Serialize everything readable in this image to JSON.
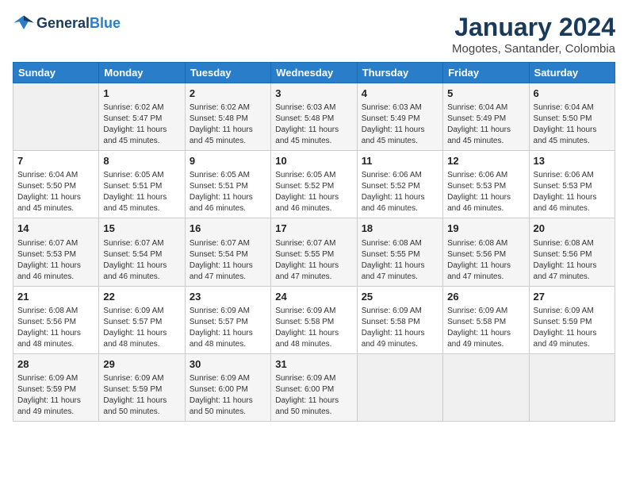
{
  "header": {
    "logo_line1": "General",
    "logo_line2": "Blue",
    "main_title": "January 2024",
    "subtitle": "Mogotes, Santander, Colombia"
  },
  "columns": [
    "Sunday",
    "Monday",
    "Tuesday",
    "Wednesday",
    "Thursday",
    "Friday",
    "Saturday"
  ],
  "weeks": [
    [
      {
        "day": "",
        "info": ""
      },
      {
        "day": "1",
        "info": "Sunrise: 6:02 AM\nSunset: 5:47 PM\nDaylight: 11 hours\nand 45 minutes."
      },
      {
        "day": "2",
        "info": "Sunrise: 6:02 AM\nSunset: 5:48 PM\nDaylight: 11 hours\nand 45 minutes."
      },
      {
        "day": "3",
        "info": "Sunrise: 6:03 AM\nSunset: 5:48 PM\nDaylight: 11 hours\nand 45 minutes."
      },
      {
        "day": "4",
        "info": "Sunrise: 6:03 AM\nSunset: 5:49 PM\nDaylight: 11 hours\nand 45 minutes."
      },
      {
        "day": "5",
        "info": "Sunrise: 6:04 AM\nSunset: 5:49 PM\nDaylight: 11 hours\nand 45 minutes."
      },
      {
        "day": "6",
        "info": "Sunrise: 6:04 AM\nSunset: 5:50 PM\nDaylight: 11 hours\nand 45 minutes."
      }
    ],
    [
      {
        "day": "7",
        "info": "Sunrise: 6:04 AM\nSunset: 5:50 PM\nDaylight: 11 hours\nand 45 minutes."
      },
      {
        "day": "8",
        "info": "Sunrise: 6:05 AM\nSunset: 5:51 PM\nDaylight: 11 hours\nand 45 minutes."
      },
      {
        "day": "9",
        "info": "Sunrise: 6:05 AM\nSunset: 5:51 PM\nDaylight: 11 hours\nand 46 minutes."
      },
      {
        "day": "10",
        "info": "Sunrise: 6:05 AM\nSunset: 5:52 PM\nDaylight: 11 hours\nand 46 minutes."
      },
      {
        "day": "11",
        "info": "Sunrise: 6:06 AM\nSunset: 5:52 PM\nDaylight: 11 hours\nand 46 minutes."
      },
      {
        "day": "12",
        "info": "Sunrise: 6:06 AM\nSunset: 5:53 PM\nDaylight: 11 hours\nand 46 minutes."
      },
      {
        "day": "13",
        "info": "Sunrise: 6:06 AM\nSunset: 5:53 PM\nDaylight: 11 hours\nand 46 minutes."
      }
    ],
    [
      {
        "day": "14",
        "info": "Sunrise: 6:07 AM\nSunset: 5:53 PM\nDaylight: 11 hours\nand 46 minutes."
      },
      {
        "day": "15",
        "info": "Sunrise: 6:07 AM\nSunset: 5:54 PM\nDaylight: 11 hours\nand 46 minutes."
      },
      {
        "day": "16",
        "info": "Sunrise: 6:07 AM\nSunset: 5:54 PM\nDaylight: 11 hours\nand 47 minutes."
      },
      {
        "day": "17",
        "info": "Sunrise: 6:07 AM\nSunset: 5:55 PM\nDaylight: 11 hours\nand 47 minutes."
      },
      {
        "day": "18",
        "info": "Sunrise: 6:08 AM\nSunset: 5:55 PM\nDaylight: 11 hours\nand 47 minutes."
      },
      {
        "day": "19",
        "info": "Sunrise: 6:08 AM\nSunset: 5:56 PM\nDaylight: 11 hours\nand 47 minutes."
      },
      {
        "day": "20",
        "info": "Sunrise: 6:08 AM\nSunset: 5:56 PM\nDaylight: 11 hours\nand 47 minutes."
      }
    ],
    [
      {
        "day": "21",
        "info": "Sunrise: 6:08 AM\nSunset: 5:56 PM\nDaylight: 11 hours\nand 48 minutes."
      },
      {
        "day": "22",
        "info": "Sunrise: 6:09 AM\nSunset: 5:57 PM\nDaylight: 11 hours\nand 48 minutes."
      },
      {
        "day": "23",
        "info": "Sunrise: 6:09 AM\nSunset: 5:57 PM\nDaylight: 11 hours\nand 48 minutes."
      },
      {
        "day": "24",
        "info": "Sunrise: 6:09 AM\nSunset: 5:58 PM\nDaylight: 11 hours\nand 48 minutes."
      },
      {
        "day": "25",
        "info": "Sunrise: 6:09 AM\nSunset: 5:58 PM\nDaylight: 11 hours\nand 49 minutes."
      },
      {
        "day": "26",
        "info": "Sunrise: 6:09 AM\nSunset: 5:58 PM\nDaylight: 11 hours\nand 49 minutes."
      },
      {
        "day": "27",
        "info": "Sunrise: 6:09 AM\nSunset: 5:59 PM\nDaylight: 11 hours\nand 49 minutes."
      }
    ],
    [
      {
        "day": "28",
        "info": "Sunrise: 6:09 AM\nSunset: 5:59 PM\nDaylight: 11 hours\nand 49 minutes."
      },
      {
        "day": "29",
        "info": "Sunrise: 6:09 AM\nSunset: 5:59 PM\nDaylight: 11 hours\nand 50 minutes."
      },
      {
        "day": "30",
        "info": "Sunrise: 6:09 AM\nSunset: 6:00 PM\nDaylight: 11 hours\nand 50 minutes."
      },
      {
        "day": "31",
        "info": "Sunrise: 6:09 AM\nSunset: 6:00 PM\nDaylight: 11 hours\nand 50 minutes."
      },
      {
        "day": "",
        "info": ""
      },
      {
        "day": "",
        "info": ""
      },
      {
        "day": "",
        "info": ""
      }
    ]
  ]
}
